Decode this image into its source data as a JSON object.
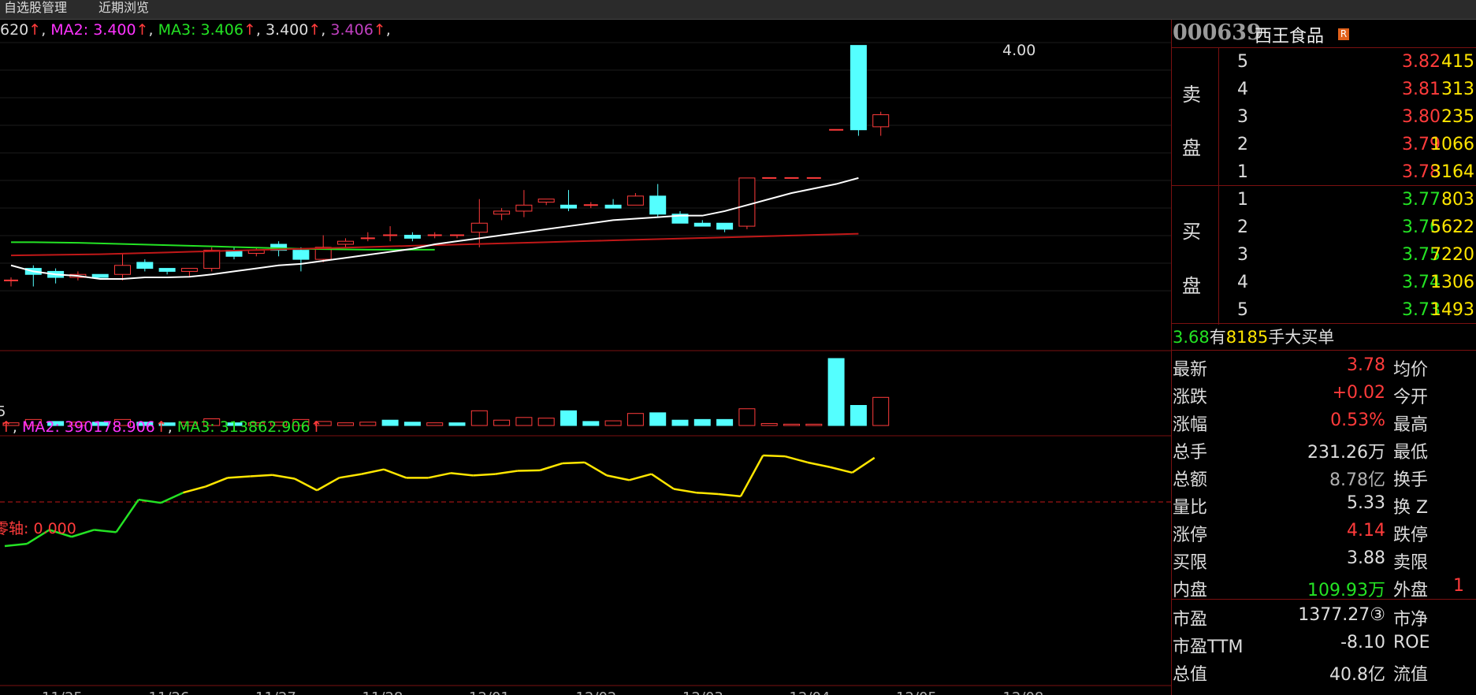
{
  "topbar": {
    "tab1": "自选股管理",
    "tab2": "近期浏览"
  },
  "price_legend": {
    "ma1_value": "620",
    "ma2_label": "MA2: 3.400",
    "ma3_label": "MA3: 3.406",
    "v4": "3.400",
    "v5": "3.406"
  },
  "price_axis_label_fragment": "5",
  "high_label": "4.00",
  "vol_legend": {
    "ma2_label": "MA2: 390178.906",
    "ma3_label": "MA3: 313862.906"
  },
  "ind_legend": {
    "label": "零轴: 0.000"
  },
  "stock": {
    "code": "000639",
    "name": "西王食品",
    "badge": "R"
  },
  "order_book": {
    "sell_label_1": "卖",
    "sell_label_2": "盘",
    "buy_label_1": "买",
    "buy_label_2": "盘",
    "sell": [
      {
        "level": "5",
        "price": "3.82",
        "volume": "415"
      },
      {
        "level": "4",
        "price": "3.81",
        "volume": "313"
      },
      {
        "level": "3",
        "price": "3.80",
        "volume": "235"
      },
      {
        "level": "2",
        "price": "3.79",
        "volume": "1066"
      },
      {
        "level": "1",
        "price": "3.78",
        "volume": "3164"
      }
    ],
    "buy": [
      {
        "level": "1",
        "price": "3.77",
        "volume": "803"
      },
      {
        "level": "2",
        "price": "3.76",
        "volume": "5622"
      },
      {
        "level": "3",
        "price": "3.75",
        "volume": "7220"
      },
      {
        "level": "4",
        "price": "3.74",
        "volume": "1306"
      },
      {
        "level": "5",
        "price": "3.73",
        "volume": "1493"
      }
    ]
  },
  "banner": {
    "price": "3.68",
    "t1": "有",
    "num": "8185",
    "t2": "手大买单"
  },
  "quote": [
    {
      "k": "最新",
      "v": "3.78",
      "vc": "red",
      "k2": "均价",
      "v2": ""
    },
    {
      "k": "涨跌",
      "v": "+0.02",
      "vc": "red",
      "k2": "今开",
      "v2": ""
    },
    {
      "k": "涨幅",
      "v": "0.53%",
      "vc": "red",
      "k2": "最高",
      "v2": ""
    },
    {
      "k": "总手",
      "v": "231.26万",
      "vc": "white",
      "k2": "最低",
      "v2": ""
    },
    {
      "k": "总额",
      "v": "8.78亿",
      "vc": "gray",
      "k2": "换手",
      "v2": ""
    },
    {
      "k": "量比",
      "v": "5.33",
      "vc": "white",
      "k2": "换 Z",
      "v2": ""
    },
    {
      "k": "涨停",
      "v": "4.14",
      "vc": "red",
      "k2": "跌停",
      "v2": ""
    },
    {
      "k": "买限",
      "v": "3.88",
      "vc": "white",
      "k2": "卖限",
      "v2": ""
    },
    {
      "k": "内盘",
      "v": "109.93万",
      "vc": "green",
      "k2": "外盘",
      "v2": "1"
    },
    {
      "k": "市盈",
      "v": "1377.27③",
      "vc": "white",
      "k2": "市净",
      "v2": ""
    },
    {
      "k": "市盈TTM",
      "v": "-8.10",
      "vc": "white",
      "k2": "ROE",
      "v2": ""
    },
    {
      "k": "总值",
      "v": "40.8亿",
      "vc": "white",
      "k2": "流值",
      "v2": ""
    }
  ],
  "colors": {
    "up": "#ff3b3b",
    "down": "#54ffff",
    "ma1": "#ffffff",
    "ma2": "#ff33ff",
    "ma3": "#24e324",
    "line": "#ffe600"
  },
  "chart_data": {
    "type": "candlestick",
    "y_range": [
      3.0,
      4.02
    ],
    "candles": [
      {
        "o": 3.22,
        "h": 3.23,
        "l": 3.2,
        "c": 3.22
      },
      {
        "o": 3.26,
        "h": 3.27,
        "l": 3.2,
        "c": 3.24
      },
      {
        "o": 3.25,
        "h": 3.26,
        "l": 3.21,
        "c": 3.23
      },
      {
        "o": 3.23,
        "h": 3.25,
        "l": 3.22,
        "c": 3.24
      },
      {
        "o": 3.24,
        "h": 3.24,
        "l": 3.23,
        "c": 3.23
      },
      {
        "o": 3.24,
        "h": 3.31,
        "l": 3.22,
        "c": 3.27
      },
      {
        "o": 3.28,
        "h": 3.29,
        "l": 3.25,
        "c": 3.26
      },
      {
        "o": 3.26,
        "h": 3.26,
        "l": 3.24,
        "c": 3.25
      },
      {
        "o": 3.25,
        "h": 3.26,
        "l": 3.23,
        "c": 3.26
      },
      {
        "o": 3.26,
        "h": 3.33,
        "l": 3.25,
        "c": 3.32
      },
      {
        "o": 3.32,
        "h": 3.33,
        "l": 3.29,
        "c": 3.3
      },
      {
        "o": 3.31,
        "h": 3.33,
        "l": 3.3,
        "c": 3.32
      },
      {
        "o": 3.34,
        "h": 3.35,
        "l": 3.3,
        "c": 3.32
      },
      {
        "o": 3.32,
        "h": 3.33,
        "l": 3.25,
        "c": 3.29
      },
      {
        "o": 3.29,
        "h": 3.37,
        "l": 3.28,
        "c": 3.33
      },
      {
        "o": 3.34,
        "h": 3.36,
        "l": 3.33,
        "c": 3.35
      },
      {
        "o": 3.36,
        "h": 3.38,
        "l": 3.35,
        "c": 3.36
      },
      {
        "o": 3.37,
        "h": 3.4,
        "l": 3.35,
        "c": 3.37
      },
      {
        "o": 3.37,
        "h": 3.38,
        "l": 3.35,
        "c": 3.36
      },
      {
        "o": 3.37,
        "h": 3.38,
        "l": 3.36,
        "c": 3.37
      },
      {
        "o": 3.37,
        "h": 3.37,
        "l": 3.36,
        "c": 3.37
      },
      {
        "o": 3.38,
        "h": 3.49,
        "l": 3.33,
        "c": 3.41
      },
      {
        "o": 3.44,
        "h": 3.46,
        "l": 3.42,
        "c": 3.45
      },
      {
        "o": 3.45,
        "h": 3.52,
        "l": 3.43,
        "c": 3.47
      },
      {
        "o": 3.48,
        "h": 3.49,
        "l": 3.47,
        "c": 3.49
      },
      {
        "o": 3.47,
        "h": 3.52,
        "l": 3.45,
        "c": 3.46
      },
      {
        "o": 3.47,
        "h": 3.48,
        "l": 3.46,
        "c": 3.47
      },
      {
        "o": 3.47,
        "h": 3.49,
        "l": 3.46,
        "c": 3.46
      },
      {
        "o": 3.47,
        "h": 3.51,
        "l": 3.47,
        "c": 3.5
      },
      {
        "o": 3.5,
        "h": 3.54,
        "l": 3.43,
        "c": 3.44
      },
      {
        "o": 3.44,
        "h": 3.45,
        "l": 3.41,
        "c": 3.41
      },
      {
        "o": 3.41,
        "h": 3.42,
        "l": 3.4,
        "c": 3.4
      },
      {
        "o": 3.41,
        "h": 3.41,
        "l": 3.38,
        "c": 3.39
      },
      {
        "o": 3.4,
        "h": 3.56,
        "l": 3.39,
        "c": 3.56
      },
      {
        "o": 3.56,
        "h": 3.56,
        "l": 3.56,
        "c": 3.56
      },
      {
        "o": 3.56,
        "h": 3.56,
        "l": 3.56,
        "c": 3.56
      },
      {
        "o": 3.56,
        "h": 3.56,
        "l": 3.56,
        "c": 3.56
      },
      {
        "o": 3.72,
        "h": 3.72,
        "l": 3.72,
        "c": 3.72
      },
      {
        "o": 4.0,
        "h": 4.0,
        "l": 3.7,
        "c": 3.72
      },
      {
        "o": 3.73,
        "h": 3.78,
        "l": 3.7,
        "c": 3.77
      }
    ],
    "ma_white": [
      3.27,
      3.25,
      3.24,
      3.235,
      3.225,
      3.225,
      3.23,
      3.23,
      3.232,
      3.24,
      3.25,
      3.26,
      3.27,
      3.275,
      3.285,
      3.295,
      3.305,
      3.315,
      3.325,
      3.34,
      3.35,
      3.36,
      3.37,
      3.38,
      3.39,
      3.4,
      3.41,
      3.42,
      3.425,
      3.43,
      3.435,
      3.435,
      3.45,
      3.47,
      3.49,
      3.51,
      3.525,
      3.54,
      3.56
    ],
    "ma_green": [
      3.347,
      3.347,
      3.346,
      3.345,
      3.343,
      3.341,
      3.339,
      3.337,
      3.335,
      3.333,
      3.331,
      3.329,
      3.327,
      3.325,
      3.324,
      3.323,
      3.322,
      3.322,
      3.322,
      3.322
    ],
    "ma_red": [
      3.303,
      3.304,
      3.305,
      3.306,
      3.307,
      3.309,
      3.311,
      3.313,
      3.315,
      3.317,
      3.319,
      3.321,
      3.323,
      3.325,
      3.327,
      3.329,
      3.331,
      3.333,
      3.335,
      3.337,
      3.339,
      3.341,
      3.343,
      3.345,
      3.347,
      3.349,
      3.351,
      3.353,
      3.355,
      3.357,
      3.359,
      3.361,
      3.363,
      3.365,
      3.367,
      3.369,
      3.371,
      3.373,
      3.375
    ],
    "volumes": [
      0.04,
      0.09,
      0.06,
      0.05,
      0.05,
      0.09,
      0.05,
      0.04,
      0.05,
      0.1,
      0.04,
      0.04,
      0.05,
      0.09,
      0.06,
      0.04,
      0.05,
      0.08,
      0.05,
      0.04,
      0.04,
      0.22,
      0.08,
      0.12,
      0.11,
      0.22,
      0.06,
      0.07,
      0.18,
      0.19,
      0.08,
      0.09,
      0.09,
      0.25,
      0.03,
      0.02,
      0.02,
      1.0,
      0.3,
      0.42
    ],
    "vol_up": [
      1,
      1,
      0,
      1,
      0,
      1,
      0,
      0,
      1,
      1,
      0,
      1,
      1,
      1,
      1,
      1,
      1,
      0,
      0,
      1,
      0,
      1,
      1,
      1,
      1,
      0,
      0,
      1,
      1,
      0,
      0,
      0,
      0,
      1,
      1,
      1,
      1,
      0,
      0,
      1
    ],
    "indicator": [
      -0.95,
      -0.9,
      -0.6,
      -0.75,
      -0.6,
      -0.65,
      0.05,
      -0.02,
      0.2,
      0.33,
      0.52,
      0.55,
      0.58,
      0.5,
      0.25,
      0.52,
      0.6,
      0.7,
      0.52,
      0.52,
      0.62,
      0.57,
      0.6,
      0.67,
      0.68,
      0.83,
      0.85,
      0.57,
      0.47,
      0.6,
      0.28,
      0.2,
      0.17,
      0.12,
      1.0,
      0.98,
      0.85,
      0.75,
      0.63,
      0.95
    ],
    "x_labels": [
      "11/25",
      "11/26",
      "11/27",
      "11/28",
      "12/01",
      "12/02",
      "12/03",
      "12/04",
      "12/05",
      "12/08"
    ]
  }
}
